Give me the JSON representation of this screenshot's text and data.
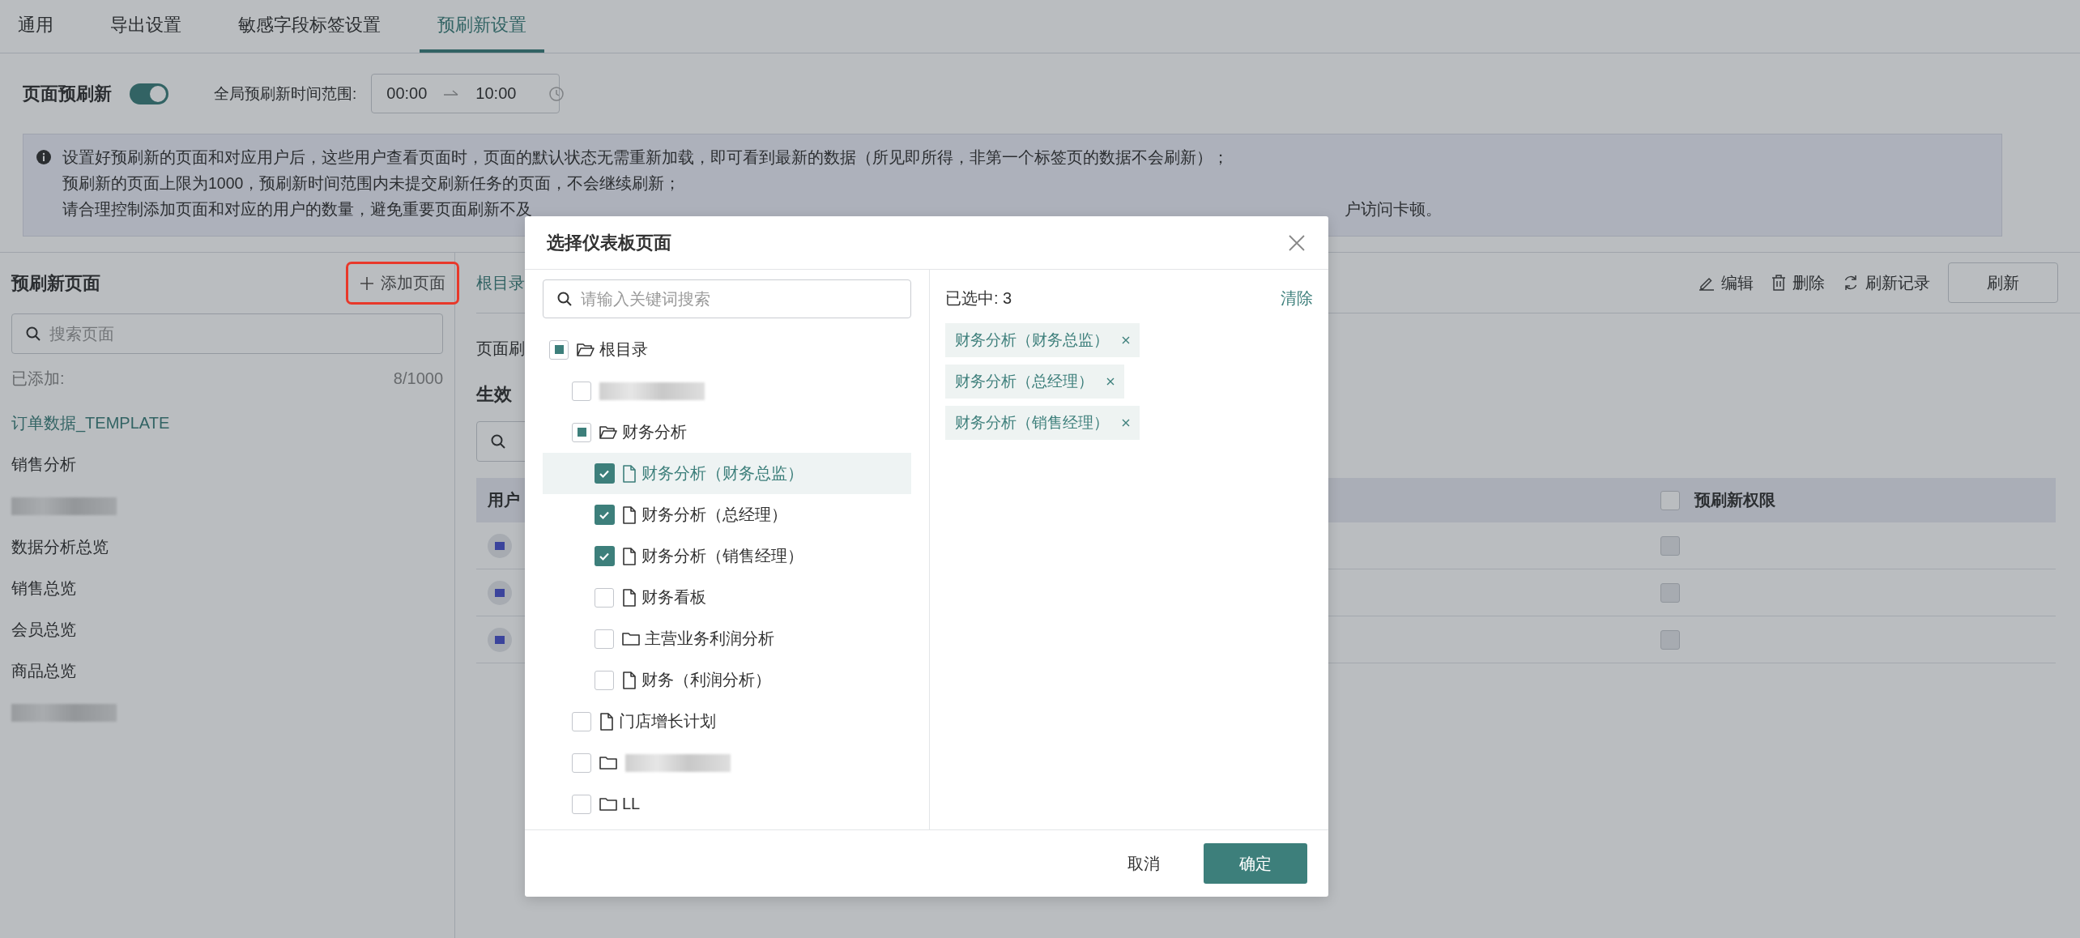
{
  "tabs": [
    {
      "label": "通用",
      "selected": false
    },
    {
      "label": "导出设置",
      "selected": false
    },
    {
      "label": "敏感字段标签设置",
      "selected": false
    },
    {
      "label": "预刷新设置",
      "selected": true
    }
  ],
  "toolbar": {
    "label": "页面预刷新",
    "toggle": {
      "on": true
    },
    "range_label": "全局预刷新时间范围:",
    "start": "00:00",
    "end": "10:00"
  },
  "notice": {
    "lines": [
      "设置好预刷新的页面和对应用户后，这些用户查看页面时，页面的默认状态无需重新加载，即可看到最新的数据（所见即所得，非第一个标签页的数据不会刷新）；",
      "预刷新的页面上限为1000，预刷新时间范围内未提交刷新任务的页面，不会继续刷新；",
      "请合理控制添加页面和对应的用户的数量，避免重要页面刷新不及"
    ],
    "last_line_end": "户访问卡顿。"
  },
  "sidebar": {
    "title": "预刷新页面",
    "add_button": "添加页面",
    "search": {
      "placeholder": "搜索页面"
    },
    "added_label": "已添加:",
    "added_count": "8/1000",
    "items": [
      {
        "kind": "page",
        "label": "订单数据_TEMPLATE",
        "selected": true
      },
      {
        "kind": "page",
        "label": "销售分析",
        "selected": false
      },
      {
        "kind": "blurred",
        "selected": false
      },
      {
        "kind": "page",
        "label": "数据分析总览",
        "selected": false
      },
      {
        "kind": "page",
        "label": "销售总览",
        "selected": false
      },
      {
        "kind": "page",
        "label": "会员总览",
        "selected": false
      },
      {
        "kind": "page",
        "label": "商品总览",
        "selected": false
      },
      {
        "kind": "blurred",
        "selected": false
      }
    ]
  },
  "main": {
    "breadcrumb": "根目录",
    "actions": [
      {
        "kind": "edit",
        "label": "编辑"
      },
      {
        "kind": "delete",
        "label": "删除"
      },
      {
        "kind": "history",
        "label": "刷新记录"
      }
    ],
    "refresh_button": "刷新",
    "section_label": "页面刷",
    "users_title": "生效",
    "table": {
      "columns": [
        "用户",
        "预刷新权限"
      ],
      "header_checked": false,
      "rows": [
        {
          "checked": false,
          "disabled": true
        },
        {
          "checked": false,
          "disabled": true
        },
        {
          "checked": false,
          "disabled": true
        }
      ]
    }
  },
  "dialog": {
    "title": "选择仪表板页面",
    "search": {
      "placeholder": "请输入关键词搜索"
    },
    "tree": [
      {
        "kind": "folder",
        "expanded": true,
        "label": "根目录",
        "checked": false,
        "partial": true,
        "selected": false,
        "children": [
          {
            "kind": "blurred",
            "checked": false,
            "partial": false,
            "selected": false
          },
          {
            "kind": "folder",
            "expanded": true,
            "label": "财务分析",
            "checked": false,
            "partial": true,
            "selected": false,
            "children": [
              {
                "kind": "page",
                "label": "财务分析（财务总监）",
                "checked": true,
                "partial": false,
                "selected": true
              },
              {
                "kind": "page",
                "label": "财务分析（总经理）",
                "checked": true,
                "partial": false,
                "selected": false
              },
              {
                "kind": "page",
                "label": "财务分析（销售经理）",
                "checked": true,
                "partial": false,
                "selected": false
              },
              {
                "kind": "page",
                "label": "财务看板",
                "checked": false,
                "partial": false,
                "selected": false
              },
              {
                "kind": "folder",
                "expanded": false,
                "label": "主营业务利润分析",
                "checked": false,
                "partial": false,
                "selected": false
              },
              {
                "kind": "page",
                "label": "财务（利润分析）",
                "checked": false,
                "partial": false,
                "selected": false
              }
            ]
          },
          {
            "kind": "page",
            "label": "门店增长计划",
            "checked": false,
            "partial": false,
            "selected": false
          },
          {
            "kind": "folder",
            "expanded": false,
            "blurred": true,
            "checked": false,
            "partial": false,
            "selected": false
          },
          {
            "kind": "folder",
            "expanded": false,
            "label": "LL",
            "checked": false,
            "partial": false,
            "selected": false
          }
        ]
      }
    ],
    "selected_count": "已选中: 3",
    "clear": "清除",
    "tags": [
      "财务分析（财务总监）",
      "财务分析（总经理）",
      "财务分析（销售经理）"
    ],
    "cancel": "取消",
    "confirm": "确定"
  }
}
